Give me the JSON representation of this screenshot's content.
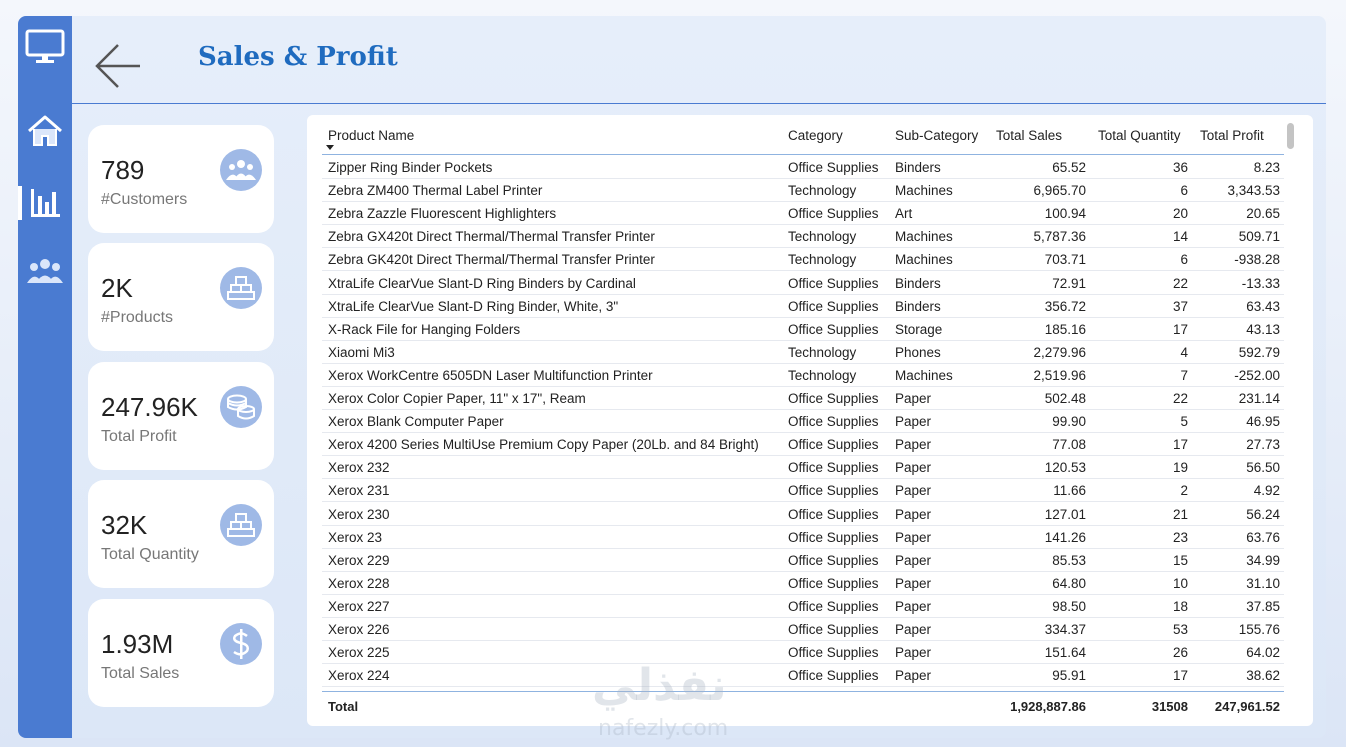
{
  "header": {
    "title": "Sales & Profit"
  },
  "nav": {
    "items": [
      {
        "icon": "monitor-icon",
        "label": ""
      },
      {
        "icon": "home-icon",
        "label": ""
      },
      {
        "icon": "bar-chart-icon",
        "label": "",
        "active": true
      },
      {
        "icon": "users-icon",
        "label": ""
      }
    ]
  },
  "cards": [
    {
      "value": "789",
      "label": "#Customers",
      "icon": "users-icon"
    },
    {
      "value": "2K",
      "label": "#Products",
      "icon": "boxes-icon"
    },
    {
      "value": "247.96K",
      "label": "Total Profit",
      "icon": "coins-icon"
    },
    {
      "value": "32K",
      "label": "Total Quantity",
      "icon": "boxes-icon"
    },
    {
      "value": "1.93M",
      "label": "Total Sales",
      "icon": "dollar-icon"
    }
  ],
  "table": {
    "columns": [
      "Product Name",
      "Category",
      "Sub-Category",
      "Total Sales",
      "Total Quantity",
      "Total Profit"
    ],
    "rows": [
      [
        "Zipper Ring Binder Pockets",
        "Office Supplies",
        "Binders",
        "65.52",
        "36",
        "8.23"
      ],
      [
        "Zebra ZM400 Thermal Label Printer",
        "Technology",
        "Machines",
        "6,965.70",
        "6",
        "3,343.53"
      ],
      [
        "Zebra Zazzle Fluorescent Highlighters",
        "Office Supplies",
        "Art",
        "100.94",
        "20",
        "20.65"
      ],
      [
        "Zebra GX420t Direct Thermal/Thermal Transfer Printer",
        "Technology",
        "Machines",
        "5,787.36",
        "14",
        "509.71"
      ],
      [
        "Zebra GK420t Direct Thermal/Thermal Transfer Printer",
        "Technology",
        "Machines",
        "703.71",
        "6",
        "-938.28"
      ],
      [
        "XtraLife ClearVue Slant-D Ring Binders by Cardinal",
        "Office Supplies",
        "Binders",
        "72.91",
        "22",
        "-13.33"
      ],
      [
        "XtraLife ClearVue Slant-D Ring Binder, White, 3\"",
        "Office Supplies",
        "Binders",
        "356.72",
        "37",
        "63.43"
      ],
      [
        "X-Rack File for Hanging Folders",
        "Office Supplies",
        "Storage",
        "185.16",
        "17",
        "43.13"
      ],
      [
        "Xiaomi Mi3",
        "Technology",
        "Phones",
        "2,279.96",
        "4",
        "592.79"
      ],
      [
        "Xerox WorkCentre 6505DN Laser Multifunction Printer",
        "Technology",
        "Machines",
        "2,519.96",
        "7",
        "-252.00"
      ],
      [
        "Xerox Color Copier Paper, 11\" x 17\", Ream",
        "Office Supplies",
        "Paper",
        "502.48",
        "22",
        "231.14"
      ],
      [
        "Xerox Blank Computer Paper",
        "Office Supplies",
        "Paper",
        "99.90",
        "5",
        "46.95"
      ],
      [
        "Xerox 4200 Series MultiUse Premium Copy Paper (20Lb. and 84 Bright)",
        "Office Supplies",
        "Paper",
        "77.08",
        "17",
        "27.73"
      ],
      [
        "Xerox 232",
        "Office Supplies",
        "Paper",
        "120.53",
        "19",
        "56.50"
      ],
      [
        "Xerox 231",
        "Office Supplies",
        "Paper",
        "11.66",
        "2",
        "4.92"
      ],
      [
        "Xerox 230",
        "Office Supplies",
        "Paper",
        "127.01",
        "21",
        "56.24"
      ],
      [
        "Xerox 23",
        "Office Supplies",
        "Paper",
        "141.26",
        "23",
        "63.76"
      ],
      [
        "Xerox 229",
        "Office Supplies",
        "Paper",
        "85.53",
        "15",
        "34.99"
      ],
      [
        "Xerox 228",
        "Office Supplies",
        "Paper",
        "64.80",
        "10",
        "31.10"
      ],
      [
        "Xerox 227",
        "Office Supplies",
        "Paper",
        "98.50",
        "18",
        "37.85"
      ],
      [
        "Xerox 226",
        "Office Supplies",
        "Paper",
        "334.37",
        "53",
        "155.76"
      ],
      [
        "Xerox 225",
        "Office Supplies",
        "Paper",
        "151.64",
        "26",
        "64.02"
      ],
      [
        "Xerox 224",
        "Office Supplies",
        "Paper",
        "95.91",
        "17",
        "38.62"
      ]
    ],
    "total": {
      "label": "Total",
      "sales": "1,928,887.86",
      "quantity": "31508",
      "profit": "247,961.52"
    }
  },
  "watermark": {
    "arabic": "نفذلي",
    "latin": "nafezly.com"
  },
  "colors": {
    "nav": "#4a7bd1",
    "title": "#1f6bbf",
    "icon_bg": "#9fb9e6",
    "canvas": "#e6eefa"
  }
}
